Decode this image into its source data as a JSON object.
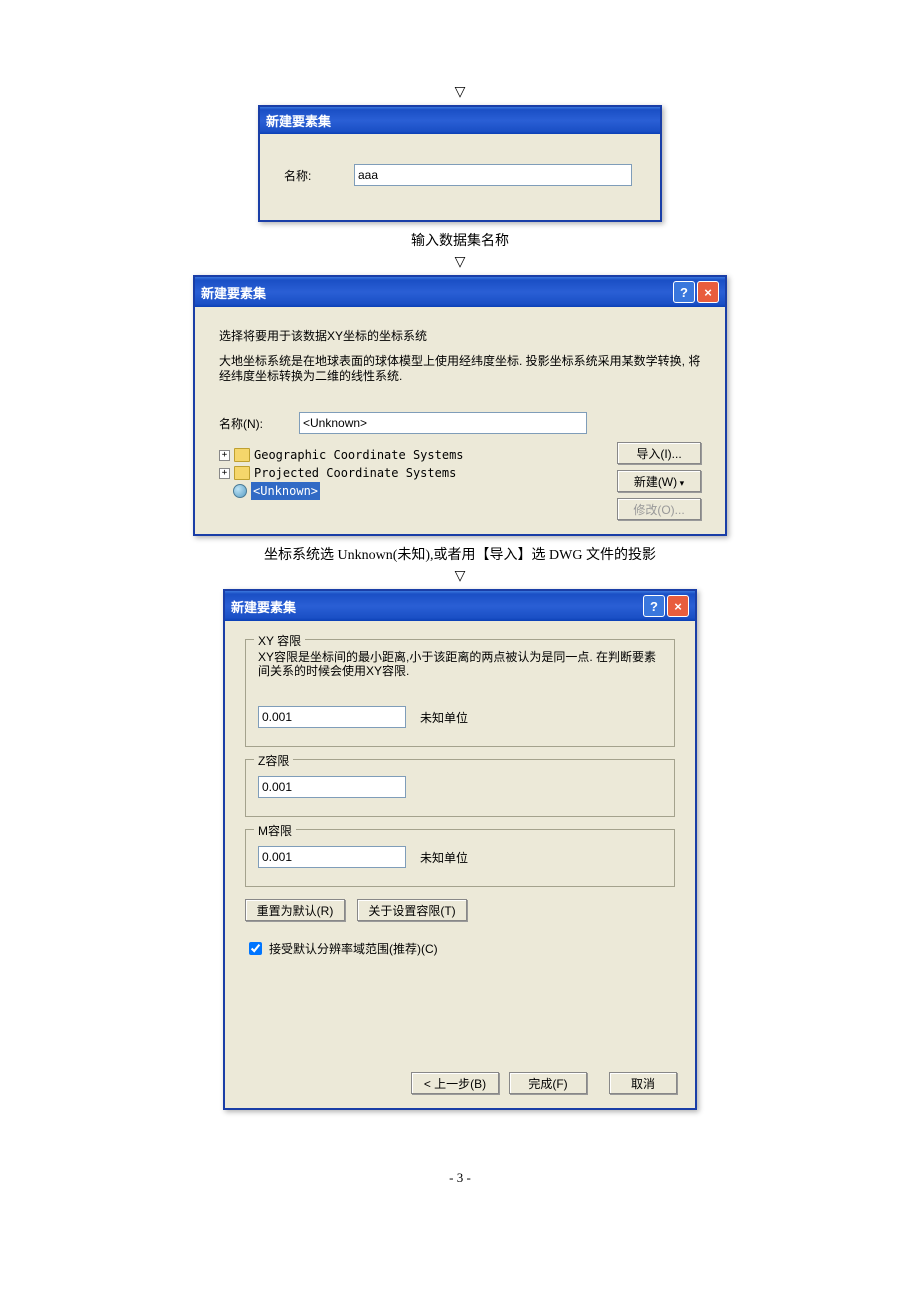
{
  "arrows": {
    "down": "▽"
  },
  "captions": {
    "c1": "输入数据集名称",
    "c2": "坐标系统选 Unknown(未知),或者用【导入】选 DWG 文件的投影"
  },
  "dlg1": {
    "title": "新建要素集",
    "name_label": "名称:",
    "name_value": "aaa"
  },
  "dlg2": {
    "title": "新建要素集",
    "intro1": "选择将要用于该数据XY坐标的坐标系统",
    "intro2": "大地坐标系统是在地球表面的球体模型上使用经纬度坐标. 投影坐标系统采用某数学转换, 将经纬度坐标转换为二维的线性系统.",
    "name_label": "名称(N):",
    "name_value": "<Unknown>",
    "tree": {
      "item1": "Geographic Coordinate Systems",
      "item2": "Projected Coordinate Systems",
      "item3": "<Unknown>"
    },
    "btn_import": "导入(I)...",
    "btn_new": "新建(W)",
    "btn_modify": "修改(O)..."
  },
  "dlg3": {
    "title": "新建要素集",
    "xy_legend": "XY 容限",
    "xy_desc": "XY容限是坐标间的最小距离,小于该距离的两点被认为是同一点. 在判断要素间关系的时候会使用XY容限.",
    "xy_value": "0.001",
    "xy_unit": "未知单位",
    "z_legend": "Z容限",
    "z_value": "0.001",
    "m_legend": "M容限",
    "m_value": "0.001",
    "m_unit": "未知单位",
    "btn_reset": "重置为默认(R)",
    "btn_about": "关于设置容限(T)",
    "check_label": "接受默认分辨率域范围(推荐)(C)",
    "btn_back": "< 上一步(B)",
    "btn_finish": "完成(F)",
    "btn_cancel": "取消"
  },
  "page_number": "- 3 -"
}
